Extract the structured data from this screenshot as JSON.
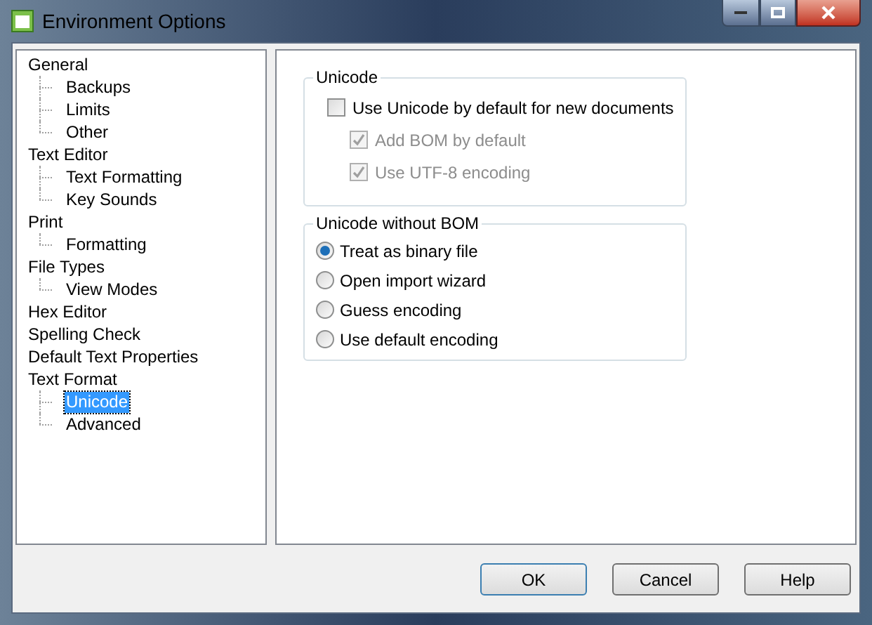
{
  "window": {
    "title": "Environment Options"
  },
  "tree": [
    {
      "label": "General",
      "selected": false,
      "children": [
        {
          "label": "Backups",
          "selected": false
        },
        {
          "label": "Limits",
          "selected": false
        },
        {
          "label": "Other",
          "selected": false
        }
      ]
    },
    {
      "label": "Text Editor",
      "selected": false,
      "children": [
        {
          "label": "Text Formatting",
          "selected": false
        },
        {
          "label": "Key Sounds",
          "selected": false
        }
      ]
    },
    {
      "label": "Print",
      "selected": false,
      "children": [
        {
          "label": "Formatting",
          "selected": false
        }
      ]
    },
    {
      "label": "File Types",
      "selected": false,
      "children": [
        {
          "label": "View Modes",
          "selected": false
        }
      ]
    },
    {
      "label": "Hex Editor",
      "selected": false
    },
    {
      "label": "Spelling Check",
      "selected": false
    },
    {
      "label": "Default Text Properties",
      "selected": false
    },
    {
      "label": "Text Format",
      "selected": false,
      "children": [
        {
          "label": "Unicode",
          "selected": true
        },
        {
          "label": "Advanced",
          "selected": false
        }
      ]
    }
  ],
  "unicode_group": {
    "title": "Unicode",
    "options": [
      {
        "label": "Use Unicode by default for new documents",
        "checked": false,
        "disabled": false,
        "indented": false
      },
      {
        "label": "Add BOM by default",
        "checked": true,
        "disabled": true,
        "indented": true
      },
      {
        "label": "Use UTF-8 encoding",
        "checked": true,
        "disabled": true,
        "indented": true
      }
    ]
  },
  "bom_group": {
    "title": "Unicode without BOM",
    "options": [
      {
        "label": "Treat as binary file",
        "selected": true
      },
      {
        "label": "Open import wizard",
        "selected": false
      },
      {
        "label": "Guess encoding",
        "selected": false
      },
      {
        "label": "Use default encoding",
        "selected": false
      }
    ]
  },
  "buttons": [
    {
      "label": "OK",
      "default": true
    },
    {
      "label": "Cancel",
      "default": false
    },
    {
      "label": "Help",
      "default": false
    }
  ]
}
